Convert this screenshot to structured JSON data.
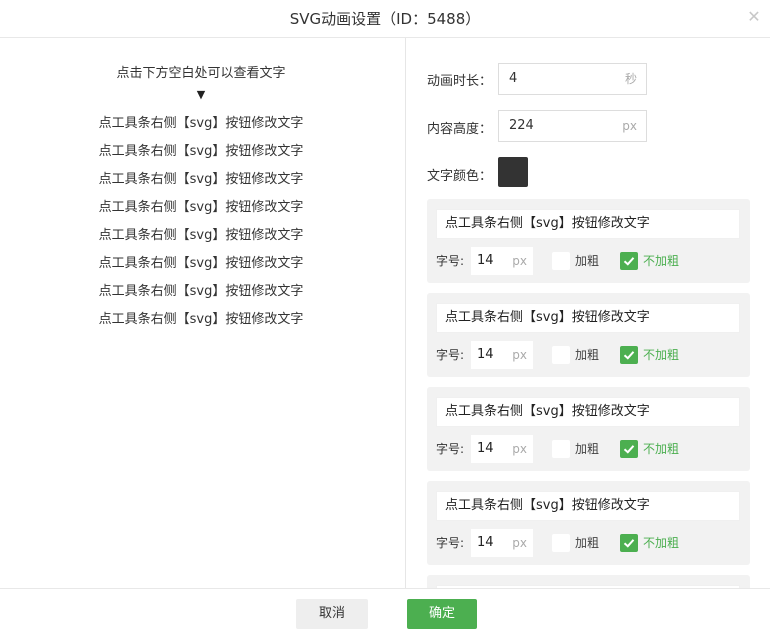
{
  "dialog": {
    "title": "SVG动画设置（ID：5488）",
    "close_icon": "close-icon"
  },
  "preview": {
    "hint": "点击下方空白处可以查看文字",
    "arrow": "▼",
    "lines": [
      "点工具条右侧【svg】按钮修改文字",
      "点工具条右侧【svg】按钮修改文字",
      "点工具条右侧【svg】按钮修改文字",
      "点工具条右侧【svg】按钮修改文字",
      "点工具条右侧【svg】按钮修改文字",
      "点工具条右侧【svg】按钮修改文字",
      "点工具条右侧【svg】按钮修改文字",
      "点工具条右侧【svg】按钮修改文字"
    ]
  },
  "settings": {
    "duration": {
      "label": "动画时长：",
      "value": "4",
      "unit": "秒"
    },
    "height": {
      "label": "内容高度：",
      "value": "224",
      "unit": "px"
    },
    "color": {
      "label": "文字颜色：",
      "value": "#333333"
    },
    "items": [
      {
        "text": "点工具条右侧【svg】按钮修改文字",
        "size_label": "字号:",
        "size": "14",
        "size_unit": "px",
        "bold_label": "加粗",
        "bold_checked": false,
        "normal_label": "不加粗",
        "normal_checked": true
      },
      {
        "text": "点工具条右侧【svg】按钮修改文字",
        "size_label": "字号:",
        "size": "14",
        "size_unit": "px",
        "bold_label": "加粗",
        "bold_checked": false,
        "normal_label": "不加粗",
        "normal_checked": true
      },
      {
        "text": "点工具条右侧【svg】按钮修改文字",
        "size_label": "字号:",
        "size": "14",
        "size_unit": "px",
        "bold_label": "加粗",
        "bold_checked": false,
        "normal_label": "不加粗",
        "normal_checked": true
      },
      {
        "text": "点工具条右侧【svg】按钮修改文字",
        "size_label": "字号:",
        "size": "14",
        "size_unit": "px",
        "bold_label": "加粗",
        "bold_checked": false,
        "normal_label": "不加粗",
        "normal_checked": true
      },
      {
        "text": "",
        "size_label": "",
        "size": "",
        "size_unit": "",
        "bold_label": "",
        "bold_checked": false,
        "normal_label": "",
        "normal_checked": true
      }
    ]
  },
  "footer": {
    "cancel_label": "取消",
    "ok_label": "确定"
  },
  "colors": {
    "accent": "#4caf50",
    "card_bg": "#f2f2f2"
  }
}
